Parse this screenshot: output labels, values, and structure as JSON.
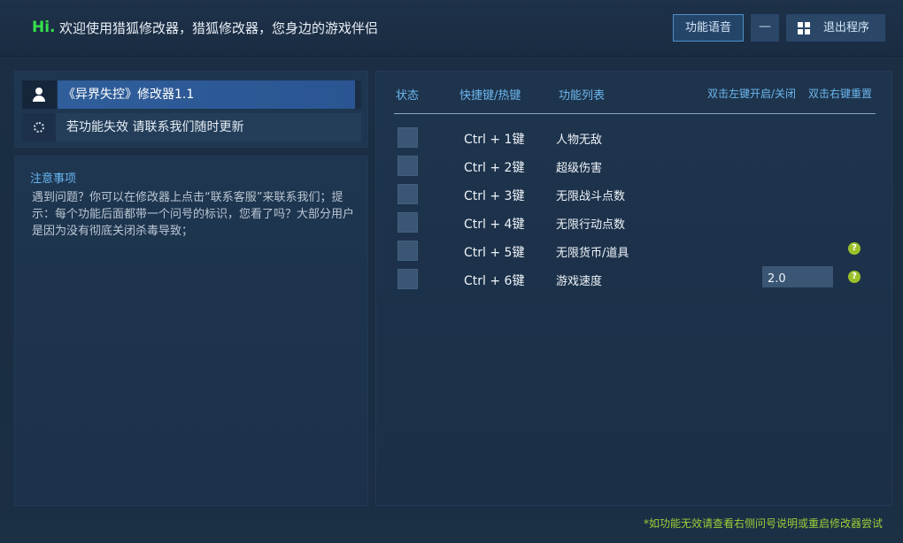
{
  "header": {
    "greeting": "Hi.",
    "welcome": "欢迎使用猎狐修改器，猎狐修改器，您身边的游戏伴侣",
    "voice_button": "功能语音",
    "minimize_button": "—",
    "exit_button": "退出程序"
  },
  "left": {
    "title_row": "《异界失控》修改器1.1",
    "tip_row": "若功能失效 请联系我们随时更新",
    "notice_title": "注意事项",
    "notice_body": "遇到问题？你可以在修改器上点击“联系客服”来联系我们；提示：每个功能后面都带一个问号的标识，您看了吗？大部分用户是因为没有彻底关闭杀毒导致；"
  },
  "table": {
    "col_status": "状态",
    "col_hotkey": "快捷键/热键",
    "col_features": "功能列表",
    "hint_left_dbl": "双击左键开启/关闭",
    "hint_right_dbl": "双击右键重置",
    "rows": [
      {
        "hotkey": "Ctrl  +  1键",
        "name": "人物无敌"
      },
      {
        "hotkey": "Ctrl  +  2键",
        "name": "超级伤害"
      },
      {
        "hotkey": "Ctrl  +  3键",
        "name": "无限战斗点数"
      },
      {
        "hotkey": "Ctrl  +  4键",
        "name": "无限行动点数"
      },
      {
        "hotkey": "Ctrl  +  5键",
        "name": "无限货币/道具",
        "help": "?"
      },
      {
        "hotkey": "Ctrl  +  6键",
        "name": "游戏速度",
        "value": "2.0",
        "help": "?"
      }
    ]
  },
  "footer": "*如功能无效请查看右侧问号说明或重启修改器尝试"
}
